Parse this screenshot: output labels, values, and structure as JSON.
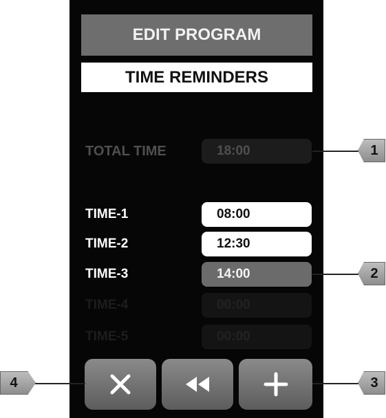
{
  "header": {
    "title": "EDIT PROGRAM",
    "subtitle": "TIME REMINDERS"
  },
  "total": {
    "label": "TOTAL TIME",
    "value": "18:00"
  },
  "times": [
    {
      "label": "TIME-1",
      "value": "08:00"
    },
    {
      "label": "TIME-2",
      "value": "12:30"
    },
    {
      "label": "TIME-3",
      "value": "14:00"
    },
    {
      "label": "TIME-4",
      "value": "00:00"
    },
    {
      "label": "TIME-5",
      "value": "00:00"
    }
  ],
  "buttons": {
    "cancel_icon": "close-icon",
    "back_icon": "rewind-icon",
    "add_icon": "plus-icon"
  },
  "callouts": {
    "c1": "1",
    "c2": "2",
    "c3": "3",
    "c4": "4"
  },
  "colors": {
    "screen_bg": "#060606",
    "header_bg": "#6e6e6e",
    "selected_field": "#6b6b6b"
  }
}
